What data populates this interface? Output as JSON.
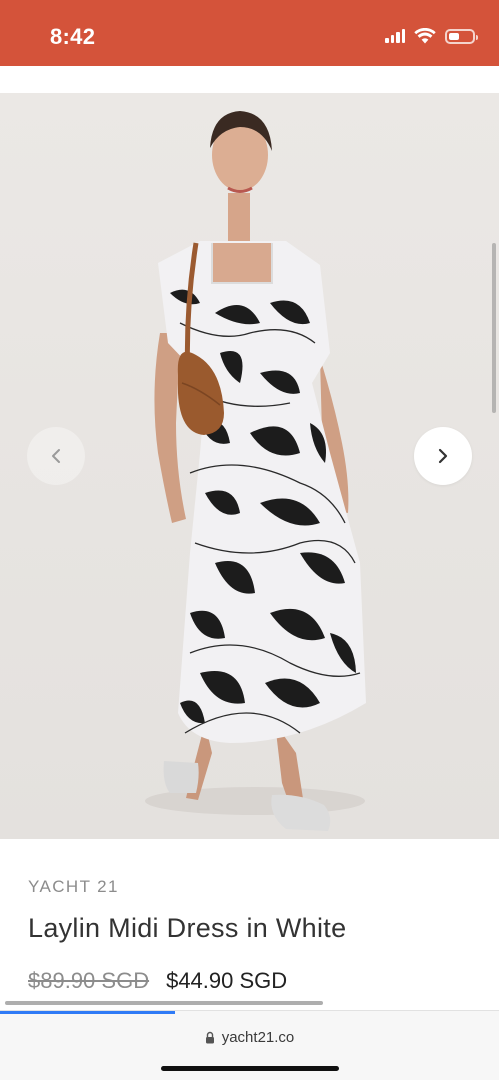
{
  "status_bar": {
    "time": "8:42",
    "background_color": "#d4533a",
    "icons": [
      "cellular-signal-icon",
      "wifi-icon",
      "battery-icon"
    ]
  },
  "product": {
    "image_alt": "Model wearing white and black floral puff-sleeve midi dress with brown shoulder bag",
    "image_count_hint": "carousel",
    "brand": "YACHT 21",
    "title": "Laylin Midi Dress in White",
    "price_original": "$89.90 SGD",
    "price_sale": "$44.90 SGD"
  },
  "carousel": {
    "prev_icon": "chevron-left-icon",
    "next_icon": "chevron-right-icon"
  },
  "browser": {
    "url": "yacht21.co",
    "secure_icon": "lock-icon",
    "load_progress": 0.35,
    "accent_color": "#2f7bf6"
  }
}
